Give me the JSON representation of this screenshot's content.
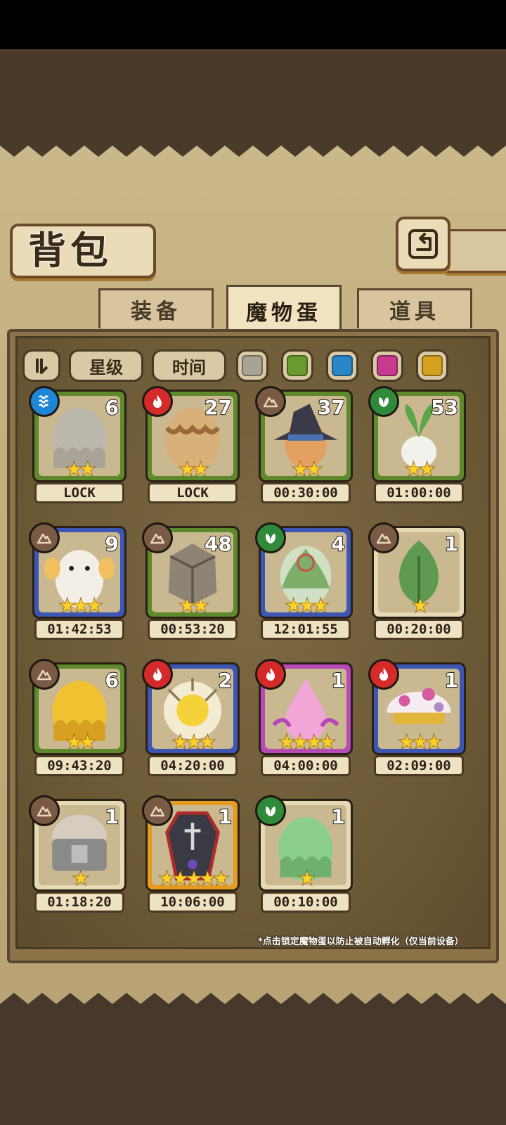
{
  "header": {
    "title": "背包"
  },
  "tabs": [
    {
      "label": "装备",
      "active": false
    },
    {
      "label": "魔物蛋",
      "active": true
    },
    {
      "label": "道具",
      "active": false
    }
  ],
  "filters": {
    "sort_label": "星级",
    "time_label": "时间"
  },
  "color_filters": [
    "#a8a392",
    "#6a9a2e",
    "#2b86c8",
    "#c83a8e",
    "#d4a21e"
  ],
  "element_colors": {
    "water": "#1e86d6",
    "fire": "#d42a2a",
    "earth": "#7a5a44",
    "wood": "#2f8a3a"
  },
  "rarity_colors": {
    "green": "#5f8a2c",
    "blue": "#3d56b4",
    "cream": "#e6d9b4",
    "purple": "#b84ab8",
    "orange": "#e69a1e"
  },
  "eggs": [
    {
      "count": "6",
      "stars": "★★",
      "timer": "LOCK",
      "element": "water",
      "frame": "green",
      "art": "grey-slime-egg"
    },
    {
      "count": "27",
      "stars": "★★",
      "timer": "LOCK",
      "element": "fire",
      "frame": "green",
      "art": "brown-slime-egg"
    },
    {
      "count": "37",
      "stars": "★★",
      "timer": "00:30:00",
      "element": "earth",
      "frame": "green",
      "art": "witch-hat-egg"
    },
    {
      "count": "53",
      "stars": "★★",
      "timer": "01:00:00",
      "element": "wood",
      "frame": "green",
      "art": "radish-egg"
    },
    {
      "count": "9",
      "stars": "★★★",
      "timer": "01:42:53",
      "element": "earth",
      "frame": "blue",
      "art": "fluffy-egg"
    },
    {
      "count": "48",
      "stars": "★★",
      "timer": "00:53:20",
      "element": "earth",
      "frame": "green",
      "art": "rock-egg"
    },
    {
      "count": "4",
      "stars": "★★★",
      "timer": "12:01:55",
      "element": "wood",
      "frame": "blue",
      "art": "leaf-swirl-egg"
    },
    {
      "count": "1",
      "stars": "★",
      "timer": "00:20:00",
      "element": "earth",
      "frame": "cream",
      "art": "sprout-egg"
    },
    {
      "count": "6",
      "stars": "★★",
      "timer": "09:43:20",
      "element": "earth",
      "frame": "green",
      "art": "gold-slime-egg"
    },
    {
      "count": "2",
      "stars": "★★★",
      "timer": "04:20:00",
      "element": "fire",
      "frame": "blue",
      "art": "sun-egg"
    },
    {
      "count": "1",
      "stars": "★★★★",
      "timer": "04:00:00",
      "element": "fire",
      "frame": "purple",
      "art": "pink-flame-egg"
    },
    {
      "count": "1",
      "stars": "★★★",
      "timer": "02:09:00",
      "element": "fire",
      "frame": "blue",
      "art": "mushroom-egg"
    },
    {
      "count": "1",
      "stars": "★",
      "timer": "01:18:20",
      "element": "earth",
      "frame": "cream",
      "art": "capsule-egg"
    },
    {
      "count": "1",
      "stars": "★★★★★",
      "timer": "10:06:00",
      "element": "earth",
      "frame": "orange",
      "art": "coffin-egg"
    },
    {
      "count": "1",
      "stars": "★",
      "timer": "00:10:00",
      "element": "wood",
      "frame": "cream",
      "art": "green-slime-egg"
    }
  ],
  "footer_note": "*点击锁定魔物蛋以防止被自动孵化（仅当前设备）"
}
